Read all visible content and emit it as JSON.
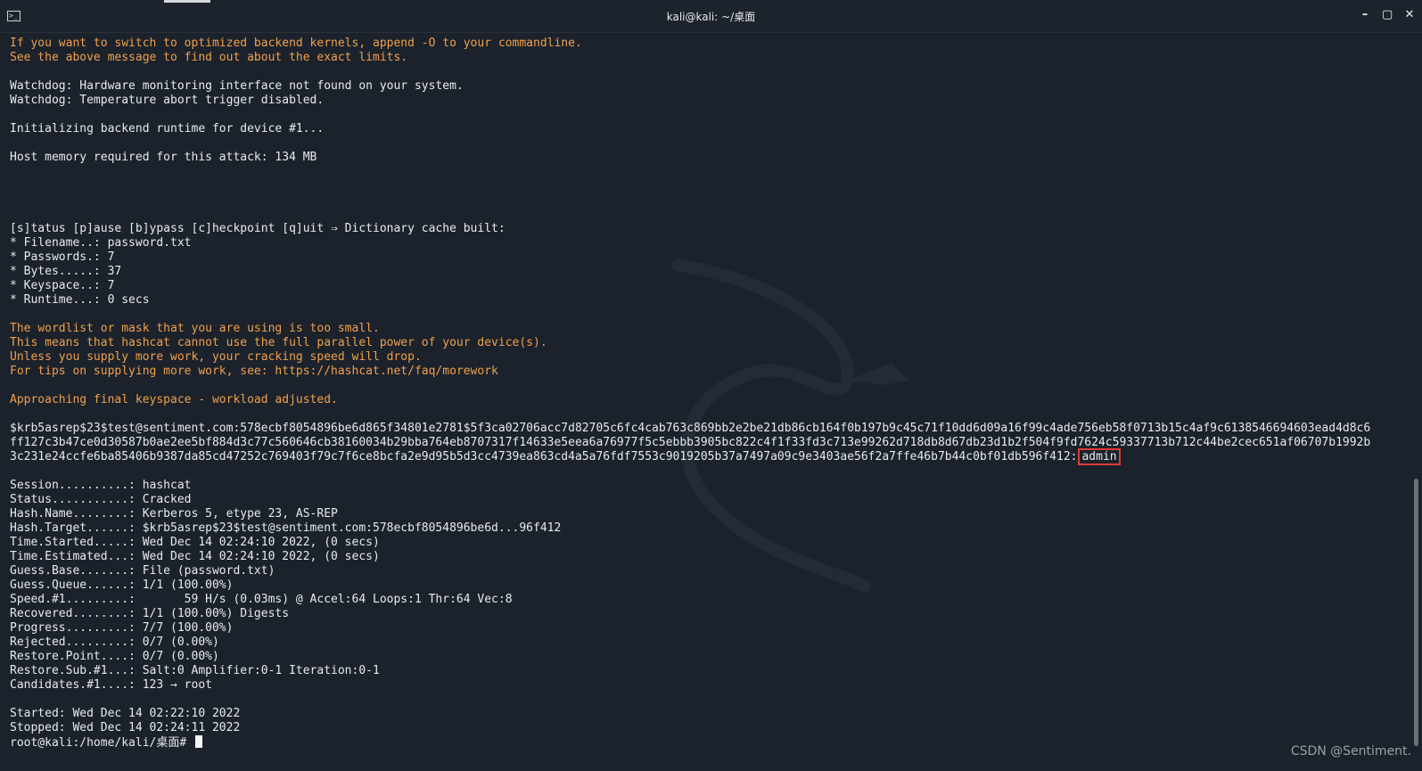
{
  "window": {
    "title": "kali@kali: ~/桌面",
    "buttons": {
      "minimize": "–",
      "maximize": "▢",
      "close": "✕"
    },
    "icon": "terminal-icon"
  },
  "terminal": {
    "lines": [
      {
        "text": "If you want to switch to optimized backend kernels, append -O to your commandline.",
        "style": "warn"
      },
      {
        "text": "See the above message to find out about the exact limits.",
        "style": "warn"
      },
      {
        "text": "",
        "style": "blank"
      },
      {
        "text": "Watchdog: Hardware monitoring interface not found on your system.",
        "style": "normal"
      },
      {
        "text": "Watchdog: Temperature abort trigger disabled.",
        "style": "normal"
      },
      {
        "text": "",
        "style": "blank"
      },
      {
        "text": "Initializing backend runtime for device #1...",
        "style": "normal"
      },
      {
        "text": "",
        "style": "blank"
      },
      {
        "text": "Host memory required for this attack: 134 MB",
        "style": "normal"
      },
      {
        "text": "",
        "style": "blank"
      },
      {
        "text": "",
        "style": "blank"
      },
      {
        "text": "",
        "style": "blank"
      },
      {
        "text": "",
        "style": "blank"
      },
      {
        "text": "[s]tatus [p]ause [b]ypass [c]heckpoint [q]uit ⇒ Dictionary cache built:",
        "style": "normal"
      },
      {
        "text": "* Filename..: password.txt",
        "style": "normal"
      },
      {
        "text": "* Passwords.: 7",
        "style": "normal"
      },
      {
        "text": "* Bytes.....: 37",
        "style": "normal"
      },
      {
        "text": "* Keyspace..: 7",
        "style": "normal"
      },
      {
        "text": "* Runtime...: 0 secs",
        "style": "normal"
      },
      {
        "text": "",
        "style": "blank"
      },
      {
        "text": "The wordlist or mask that you are using is too small.",
        "style": "warn"
      },
      {
        "text": "This means that hashcat cannot use the full parallel power of your device(s).",
        "style": "warn"
      },
      {
        "text": "Unless you supply more work, your cracking speed will drop.",
        "style": "warn"
      },
      {
        "text": "For tips on supplying more work, see: https://hashcat.net/faq/morework",
        "style": "warn"
      },
      {
        "text": "",
        "style": "blank"
      },
      {
        "text": "Approaching final keyspace - workload adjusted.",
        "style": "warn"
      },
      {
        "text": "",
        "style": "blank"
      },
      {
        "text": "$krb5asrep$23$test@sentiment.com:578ecbf8054896be6d865f34801e2781$5f3ca02706acc7d82705c6fc4cab763c869bb2e2be21db86cb164f0b197b9c45c71f10dd6d09a16f99c4ade756eb58f0713b15c4af9c6138546694603ead4d8c6",
        "style": "normal"
      },
      {
        "text": "ff127c3b47ce0d30587b0ae2ee5bf884d3c77c560646cb38160034b29bba764eb8707317f14633e5eea6a76977f5c5ebbb3905bc822c4f1f33fd3c713e99262d718db8d67db23d1b2f504f9fd7624c59337713b712c44be2cec651af06707b1992b",
        "style": "normal"
      },
      {
        "text": "3c231e24ccfe6ba85406b9387da85cd47252c769403f79c7f6ce8bcfa2e9d95b5d3cc4739ea863cd4a5a76fdf7553c9019205b37a7497a09c9e3403ae56f2a7ffe46b7b44c0bf01db596f412:",
        "style": "normal",
        "highlight": "admin"
      },
      {
        "text": "",
        "style": "blank"
      },
      {
        "text": "Session..........: hashcat",
        "style": "normal"
      },
      {
        "text": "Status...........: Cracked",
        "style": "normal"
      },
      {
        "text": "Hash.Name........: Kerberos 5, etype 23, AS-REP",
        "style": "normal"
      },
      {
        "text": "Hash.Target......: $krb5asrep$23$test@sentiment.com:578ecbf8054896be6d...96f412",
        "style": "normal"
      },
      {
        "text": "Time.Started.....: Wed Dec 14 02:24:10 2022, (0 secs)",
        "style": "normal"
      },
      {
        "text": "Time.Estimated...: Wed Dec 14 02:24:10 2022, (0 secs)",
        "style": "normal"
      },
      {
        "text": "Guess.Base.......: File (password.txt)",
        "style": "normal"
      },
      {
        "text": "Guess.Queue......: 1/1 (100.00%)",
        "style": "normal"
      },
      {
        "text": "Speed.#1.........:       59 H/s (0.03ms) @ Accel:64 Loops:1 Thr:64 Vec:8",
        "style": "normal"
      },
      {
        "text": "Recovered........: 1/1 (100.00%) Digests",
        "style": "normal"
      },
      {
        "text": "Progress.........: 7/7 (100.00%)",
        "style": "normal"
      },
      {
        "text": "Rejected.........: 0/7 (0.00%)",
        "style": "normal"
      },
      {
        "text": "Restore.Point....: 0/7 (0.00%)",
        "style": "normal"
      },
      {
        "text": "Restore.Sub.#1...: Salt:0 Amplifier:0-1 Iteration:0-1",
        "style": "normal"
      },
      {
        "text": "Candidates.#1....: 123 → root",
        "style": "normal"
      },
      {
        "text": "",
        "style": "blank"
      },
      {
        "text": "Started: Wed Dec 14 02:22:10 2022",
        "style": "normal"
      },
      {
        "text": "Stopped: Wed Dec 14 02:24:11 2022",
        "style": "normal"
      },
      {
        "text": "root@kali:/home/kali/桌面# ",
        "style": "normal",
        "cursor": true
      }
    ]
  },
  "watermark": "CSDN @Sentiment.",
  "colors": {
    "background": "#1b222c",
    "text": "#e8eaed",
    "warning": "#f0a04b",
    "highlight_box": "#e03a3a"
  }
}
